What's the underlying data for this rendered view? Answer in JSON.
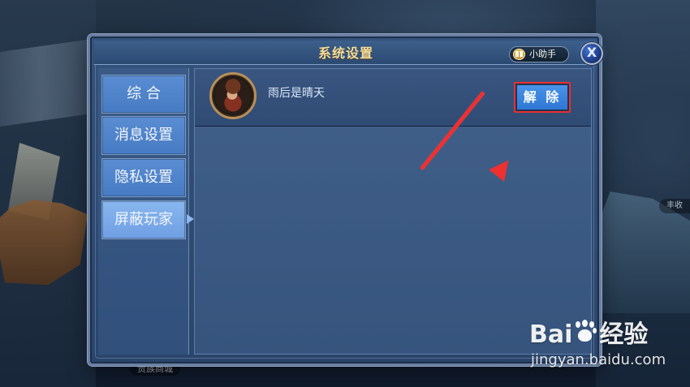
{
  "background": {
    "left_label": "贵族商城",
    "right_label": "丰收"
  },
  "dialog": {
    "title": "系统设置",
    "helper_label": "小助手",
    "close_label": "X"
  },
  "sidebar": {
    "items": [
      {
        "label": "综 合"
      },
      {
        "label": "消息设置"
      },
      {
        "label": "隐私设置"
      },
      {
        "label": "屏蔽玩家",
        "active": true
      }
    ]
  },
  "blocked_player": {
    "name": "雨后是晴天",
    "action_label": "解 除"
  },
  "watermark": {
    "brand_left": "Bai",
    "brand_right": "经验",
    "url": "jingyan.baidu.com"
  },
  "colors": {
    "dialog_blue": "#2a456b",
    "active_tab_blue": "#6f9fe3",
    "title_gold": "#f3de9f",
    "annotation_red": "#ef3030"
  },
  "icons": {
    "helper": "book-icon",
    "close": "close-icon",
    "pointer": "red-arrow"
  }
}
